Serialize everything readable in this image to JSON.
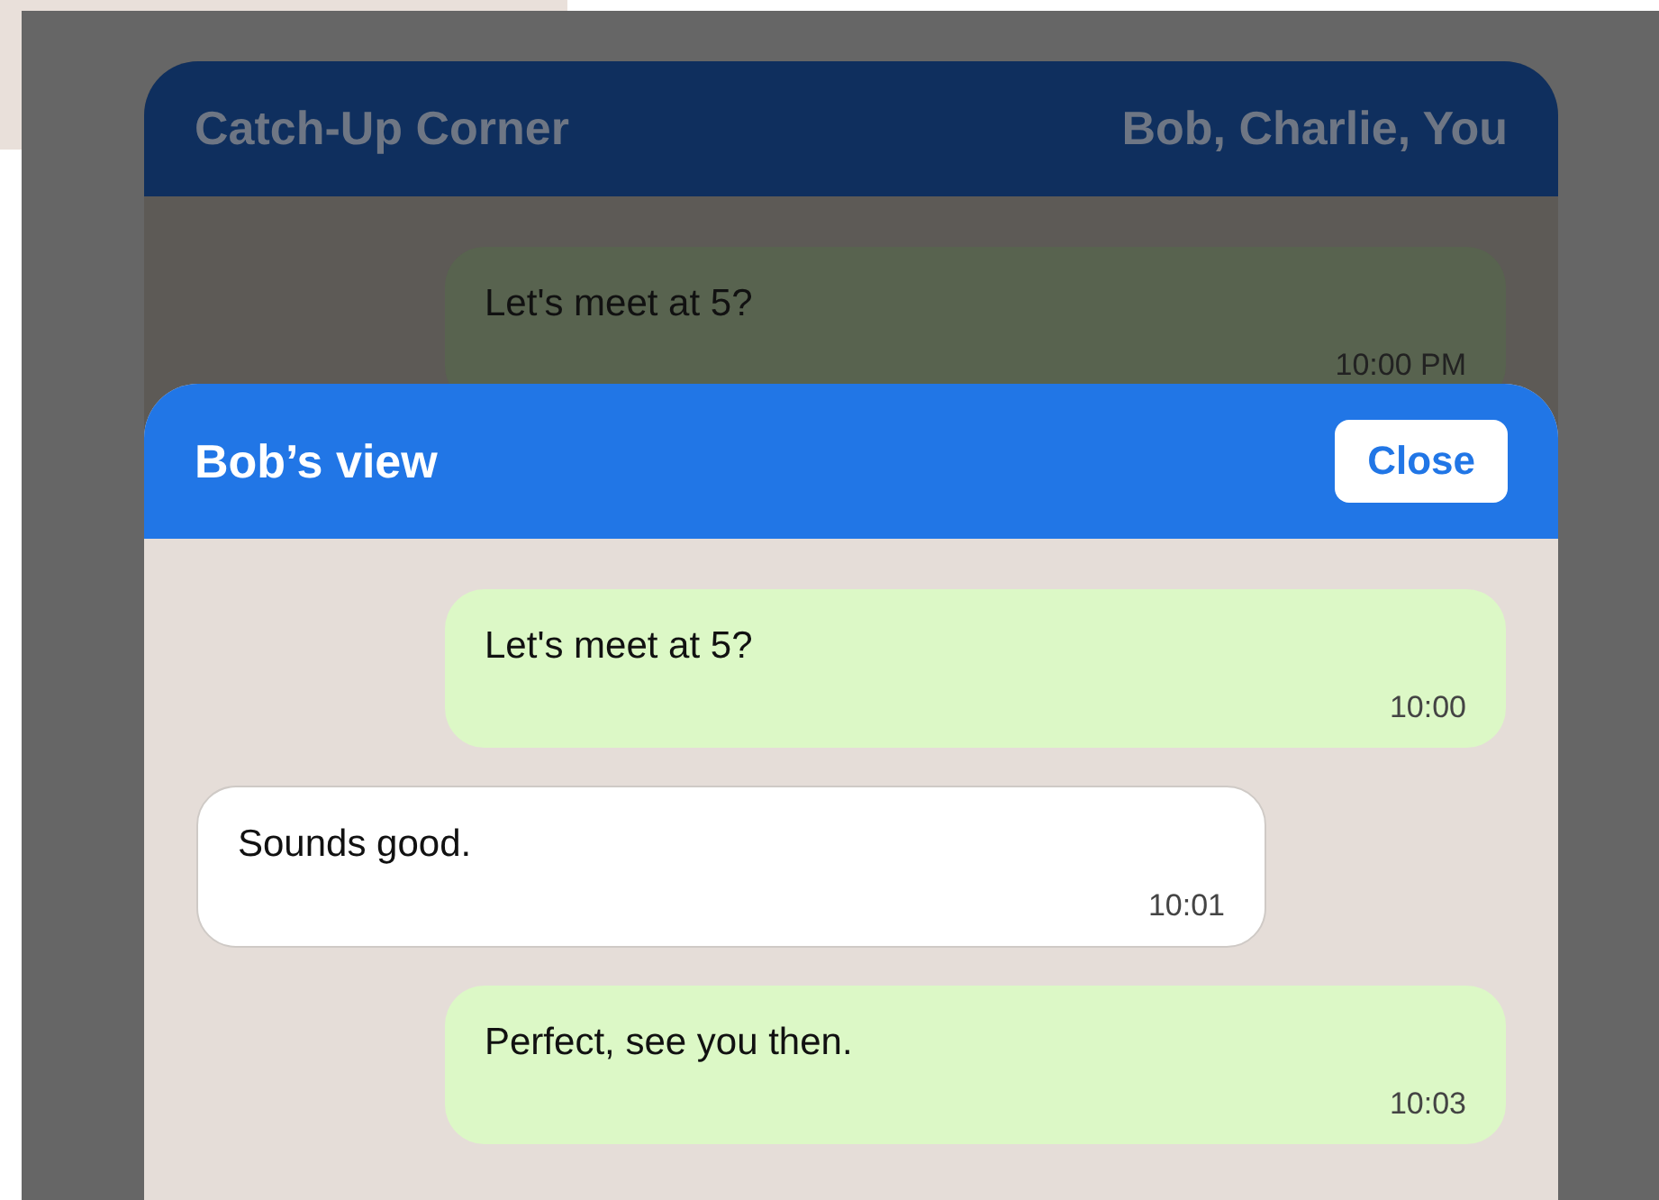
{
  "background_chat": {
    "title": "Catch-Up Corner",
    "participants": "Bob, Charlie, You",
    "messages": [
      {
        "kind": "sent",
        "text": "Let's meet at 5?",
        "time": "10:00 PM"
      }
    ]
  },
  "dialog": {
    "title": "Bob’s view",
    "close_button": "Close",
    "messages": [
      {
        "kind": "sent",
        "text": "Let's meet at 5?",
        "time": "10:00"
      },
      {
        "kind": "received",
        "text": "Sounds good.",
        "time": "10:01"
      },
      {
        "kind": "sent",
        "text": "Perfect, see you then.",
        "time": "10:03"
      }
    ]
  }
}
